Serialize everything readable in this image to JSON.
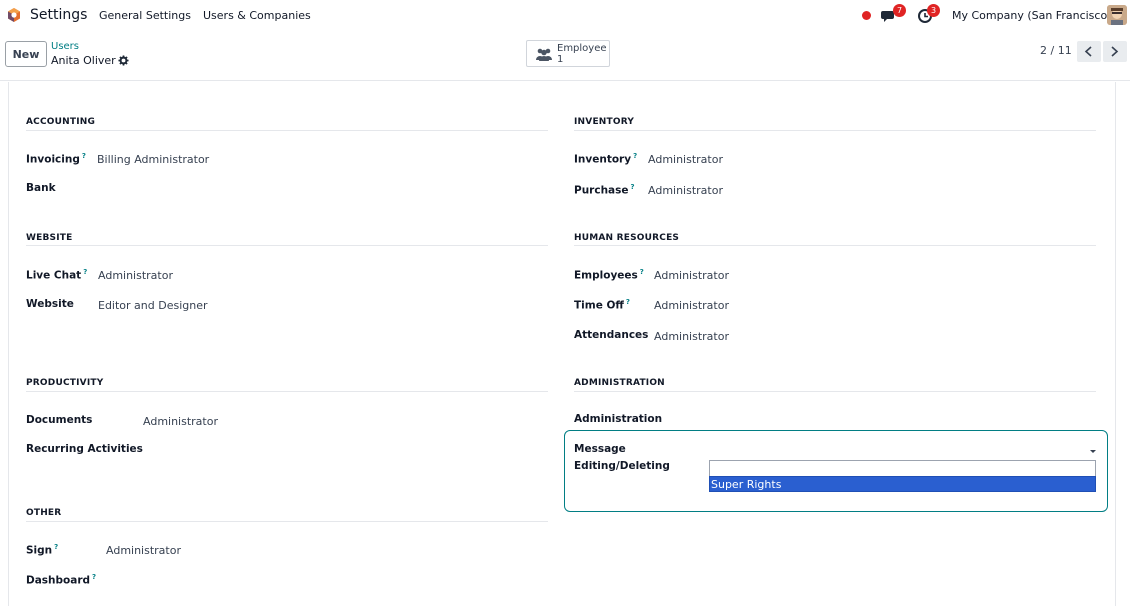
{
  "navbar": {
    "app_title": "Settings",
    "menu": [
      "General Settings",
      "Users & Companies"
    ],
    "messages_count": "7",
    "activities_count": "3",
    "company": "My Company (San Francisco)"
  },
  "control_panel": {
    "new_label": "New",
    "breadcrumb_parent": "Users",
    "breadcrumb_current": "Anita Oliver",
    "smart_button": {
      "label": "Employee",
      "value": "1"
    },
    "pager": "2 / 11"
  },
  "groups": {
    "accounting": {
      "title": "ACCOUNTING",
      "fields": [
        {
          "label": "Invoicing",
          "value": "Billing Administrator"
        },
        {
          "label": "Bank",
          "value": ""
        }
      ]
    },
    "inventory": {
      "title": "INVENTORY",
      "fields": [
        {
          "label": "Inventory",
          "value": "Administrator"
        },
        {
          "label": "Purchase",
          "value": "Administrator"
        }
      ]
    },
    "website": {
      "title": "WEBSITE",
      "fields": [
        {
          "label": "Live Chat",
          "value": "Administrator"
        },
        {
          "label": "Website",
          "value": "Editor and Designer"
        }
      ]
    },
    "human_resources": {
      "title": "HUMAN RESOURCES",
      "fields": [
        {
          "label": "Employees",
          "value": "Administrator"
        },
        {
          "label": "Time Off",
          "value": "Administrator"
        },
        {
          "label": "Attendances",
          "value": "Administrator"
        }
      ]
    },
    "productivity": {
      "title": "PRODUCTIVITY",
      "fields": [
        {
          "label": "Documents",
          "value": "Administrator"
        },
        {
          "label": "Recurring Activities",
          "value": ""
        }
      ]
    },
    "administration": {
      "title": "ADMINISTRATION",
      "fields": [
        {
          "label": "Administration",
          "value": ""
        },
        {
          "label": "Message",
          "value": ""
        },
        {
          "label": "Editing/Deleting",
          "value": ""
        }
      ],
      "dropdown": {
        "input_value": "",
        "options": [
          "Super Rights"
        ]
      }
    },
    "other": {
      "title": "OTHER",
      "fields": [
        {
          "label": "Sign",
          "value": "Administrator"
        },
        {
          "label": "Dashboard",
          "value": ""
        }
      ]
    }
  },
  "colors": {
    "accent": "#017e84",
    "badge": "#e02424",
    "selection": "#2a5fd0"
  },
  "icons": [
    "odoo-app-icon",
    "chat-icon",
    "activity-clock-icon",
    "gear-icon",
    "employees-icon",
    "chevron-left-icon",
    "chevron-right-icon",
    "dropdown-caret-icon"
  ]
}
